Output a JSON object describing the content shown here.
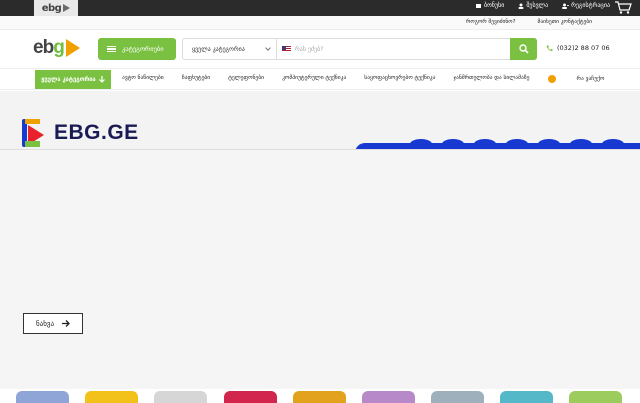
{
  "topbar": {
    "logo_text": "ebg",
    "links": [
      {
        "icon": "cards-icon",
        "label": "ბონუსი"
      },
      {
        "icon": "user-icon",
        "label": "შესვლა"
      },
      {
        "icon": "user-plus-icon",
        "label": "რეგისტრაცია"
      }
    ],
    "cart_icon": "cart-icon"
  },
  "utilbar": {
    "links": [
      "როგორ შევიძინო?",
      "მაისეთი კონტაქტები"
    ]
  },
  "header": {
    "logo_text_e": "eb",
    "logo_text_g": "g",
    "categories_label": "კატეგორიები",
    "search": {
      "select_value": "ყველა კატეგორია",
      "placeholder": "რას ეძებ?"
    },
    "phone": "(032)2 88 07 06"
  },
  "nav": {
    "all_label": "ყველა კატეგორია",
    "items": [
      "ავტო ნაწილები",
      "ჩაფხუტები",
      "ტელეფონები",
      "კომპიუტერული ტექნიკა",
      "საყოფაცხოვრებო ტექნიკა",
      "ჯანმრთელობა და სილამაზე",
      "რა ვაჩუქო"
    ]
  },
  "hero": {
    "brand_text": "EBG.GE",
    "see_label": "ნახვა"
  },
  "colors": {
    "accent_green": "#7ac142",
    "dark_top": "#2b2b2b",
    "brand_blue": "#1739d1",
    "navy": "#1a1a55"
  }
}
